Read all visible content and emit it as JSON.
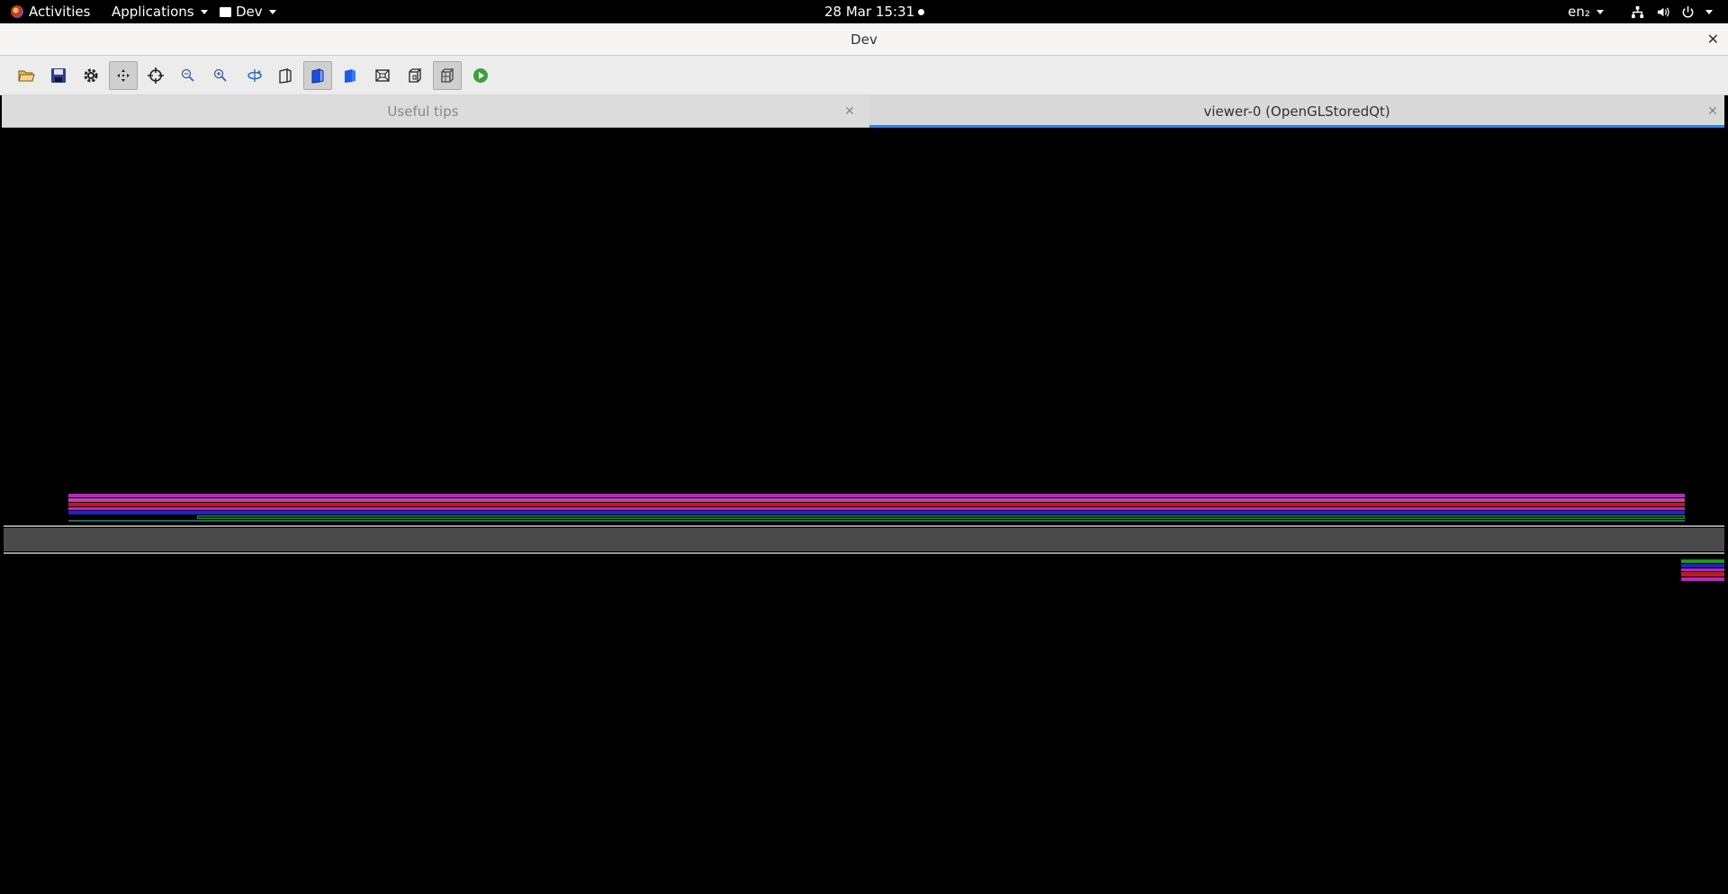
{
  "topbar": {
    "activities": "Activities",
    "applications": "Applications",
    "app_menu": "Dev",
    "clock": "28 Mar  15:31",
    "keyboard_layout": "en₂",
    "icons": [
      "network-icon",
      "volume-icon",
      "power-icon"
    ]
  },
  "window": {
    "title": "Dev",
    "close_glyph": "✕"
  },
  "toolbar": {
    "buttons": [
      {
        "name": "open-icon",
        "checked": false
      },
      {
        "name": "save-icon",
        "checked": false
      },
      {
        "name": "settings-icon",
        "checked": false
      },
      {
        "name": "pan-icon",
        "checked": true
      },
      {
        "name": "pick-icon",
        "checked": false
      },
      {
        "name": "zoom-out-icon",
        "checked": false
      },
      {
        "name": "zoom-in-icon",
        "checked": false
      },
      {
        "name": "rotate-icon",
        "checked": false
      },
      {
        "name": "wireframe-icon",
        "checked": false
      },
      {
        "name": "solid-icon",
        "checked": true
      },
      {
        "name": "solid-blue-icon",
        "checked": false
      },
      {
        "name": "perspective-icon",
        "checked": false
      },
      {
        "name": "ortho-icon",
        "checked": false
      },
      {
        "name": "box-view-icon",
        "checked": true
      },
      {
        "name": "run-icon",
        "checked": false
      }
    ]
  },
  "tabs": [
    {
      "label": "Useful tips",
      "active": false,
      "close_glyph": "✕"
    },
    {
      "label": "viewer-0 (OpenGLStoredQt)",
      "active": true,
      "close_glyph": "✕"
    }
  ],
  "colors": {
    "accent": "#3584e4",
    "magenta": "#c81ec8",
    "red": "#b41e1e",
    "blue": "#2222cc",
    "green": "#1a9a1a",
    "gray_band": "#4a4a4a"
  }
}
